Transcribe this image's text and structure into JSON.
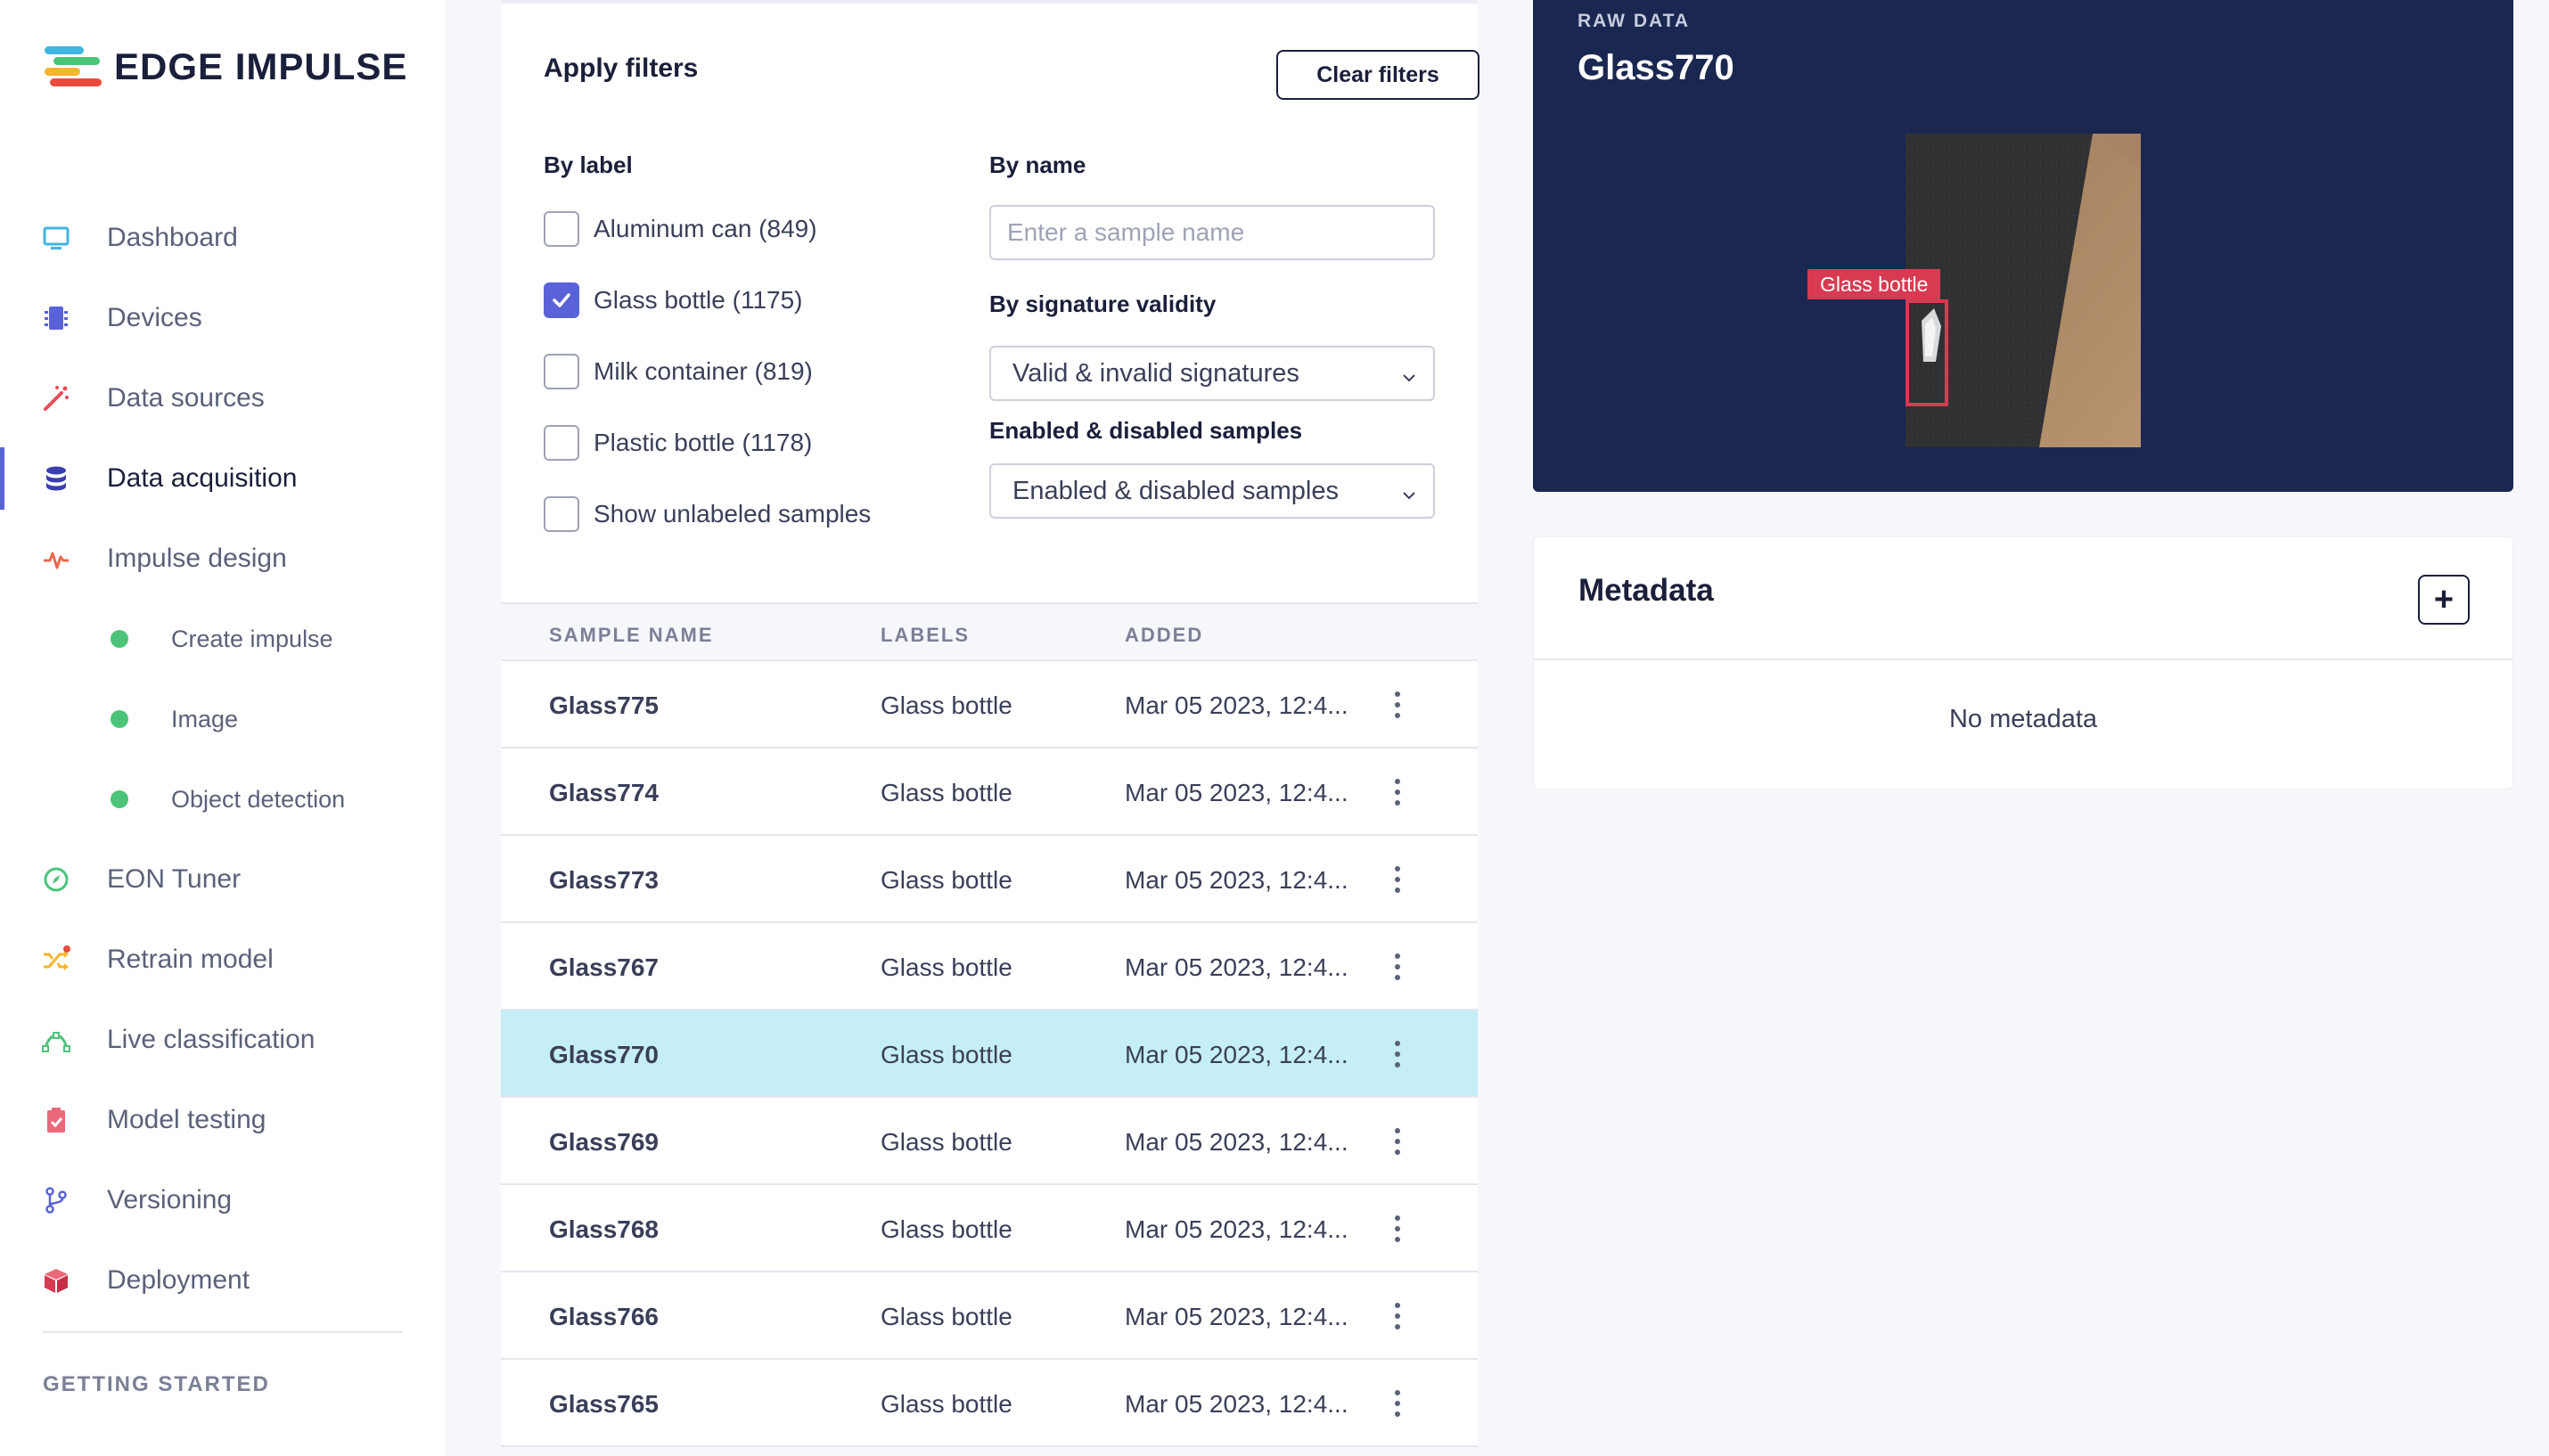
{
  "brand": {
    "name": "EDGE IMPULSE",
    "logo_colors": [
      "#e94c3d",
      "#f7b52c",
      "#4bc47a",
      "#42b4e0"
    ]
  },
  "sidebar": {
    "items": [
      {
        "label": "Dashboard",
        "icon": "monitor-icon"
      },
      {
        "label": "Devices",
        "icon": "chip-icon"
      },
      {
        "label": "Data sources",
        "icon": "magic-wand-icon"
      },
      {
        "label": "Data acquisition",
        "icon": "database-icon",
        "active": true
      },
      {
        "label": "Impulse design",
        "icon": "pulse-icon"
      },
      {
        "label": "Create impulse",
        "icon": "dot-icon",
        "sub": true
      },
      {
        "label": "Image",
        "icon": "dot-icon",
        "sub": true
      },
      {
        "label": "Object detection",
        "icon": "dot-icon",
        "sub": true
      },
      {
        "label": "EON Tuner",
        "icon": "compass-icon"
      },
      {
        "label": "Retrain model",
        "icon": "shuffle-icon"
      },
      {
        "label": "Live classification",
        "icon": "curve-icon"
      },
      {
        "label": "Model testing",
        "icon": "clipboard-check-icon"
      },
      {
        "label": "Versioning",
        "icon": "branch-icon"
      },
      {
        "label": "Deployment",
        "icon": "box-icon"
      }
    ],
    "section_title": "GETTING STARTED"
  },
  "filters": {
    "title": "Apply filters",
    "clear_label": "Clear filters",
    "by_label_title": "By label",
    "labels": [
      {
        "text": "Aluminum can (849)",
        "checked": false
      },
      {
        "text": "Glass bottle (1175)",
        "checked": true
      },
      {
        "text": "Milk container (819)",
        "checked": false
      },
      {
        "text": "Plastic bottle (1178)",
        "checked": false
      },
      {
        "text": "Show unlabeled samples",
        "checked": false
      }
    ],
    "by_name_title": "By name",
    "name_placeholder": "Enter a sample name",
    "signature_title": "By signature validity",
    "signature_value": "Valid & invalid signatures",
    "enabled_title": "Enabled & disabled samples",
    "enabled_value": "Enabled & disabled samples"
  },
  "table": {
    "headers": [
      "SAMPLE NAME",
      "LABELS",
      "ADDED"
    ],
    "rows": [
      {
        "name": "Glass775",
        "label": "Glass bottle",
        "added": "Mar 05 2023, 12:4..."
      },
      {
        "name": "Glass774",
        "label": "Glass bottle",
        "added": "Mar 05 2023, 12:4..."
      },
      {
        "name": "Glass773",
        "label": "Glass bottle",
        "added": "Mar 05 2023, 12:4..."
      },
      {
        "name": "Glass767",
        "label": "Glass bottle",
        "added": "Mar 05 2023, 12:4..."
      },
      {
        "name": "Glass770",
        "label": "Glass bottle",
        "added": "Mar 05 2023, 12:4...",
        "selected": true
      },
      {
        "name": "Glass769",
        "label": "Glass bottle",
        "added": "Mar 05 2023, 12:4..."
      },
      {
        "name": "Glass768",
        "label": "Glass bottle",
        "added": "Mar 05 2023, 12:4..."
      },
      {
        "name": "Glass766",
        "label": "Glass bottle",
        "added": "Mar 05 2023, 12:4..."
      },
      {
        "name": "Glass765",
        "label": "Glass bottle",
        "added": "Mar 05 2023, 12:4..."
      }
    ]
  },
  "raw_data": {
    "kicker": "RAW DATA",
    "title": "Glass770",
    "bbox_label": "Glass bottle"
  },
  "metadata": {
    "title": "Metadata",
    "add_label": "+",
    "empty_text": "No metadata"
  }
}
